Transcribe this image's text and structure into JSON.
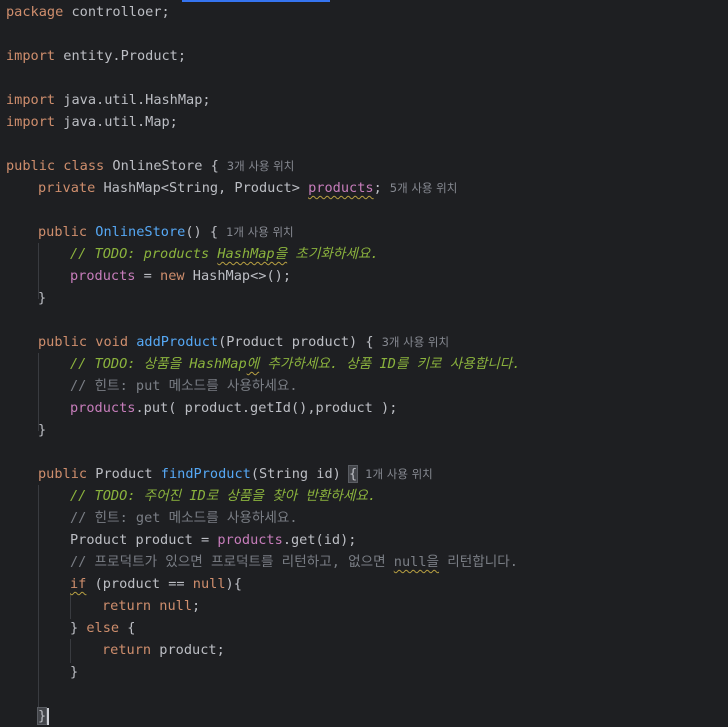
{
  "code": {
    "l1": {
      "kw": "package",
      "rest": " controlloer;"
    },
    "l2": {
      "kw": "import",
      "rest": " entity.Product;"
    },
    "l3": {
      "kw": "import",
      "rest": " java.util.HashMap;"
    },
    "l4": {
      "kw": "import",
      "rest": " java.util.Map;"
    },
    "l5": {
      "kw": "public class",
      "rest": " OnlineStore {",
      "hint": "3개 사용 위치"
    },
    "l6": {
      "kw": "private",
      "mid": " HashMap<String, Product> ",
      "field": "products",
      "end": ";",
      "hint": "5개 사용 위치"
    },
    "l7": {
      "kw": "public",
      "space": " ",
      "fn": "OnlineStore",
      "rest": "() {",
      "hint": "1개 사용 위치"
    },
    "l8": {
      "pre": "// TODO: products ",
      "w": "HashMap을",
      "post": " 초기화하세요."
    },
    "l9": {
      "field": "products",
      "mid": " = ",
      "kw": "new",
      "rest": " HashMap<>();"
    },
    "l10": {
      "text": "}"
    },
    "l11": {
      "kw": "public void",
      "space": " ",
      "fn": "addProduct",
      "rest": "(Product product) {",
      "hint": "3개 사용 위치"
    },
    "l12": {
      "pre": "// TODO: 상품을 HashMap",
      "w": "에",
      "post": " 추가하세요. 상품 ID를 키로 사용합니다."
    },
    "l13": {
      "text": "// 힌트: put 메소드를 사용하세요."
    },
    "l14": {
      "field": "products",
      "rest": ".put( product.getId(),product );"
    },
    "l15": {
      "text": "}"
    },
    "l16": {
      "kw": "public",
      "mid": " Product ",
      "fn": "findProduct",
      "rest": "(String id) ",
      "brace": "{",
      "hint": "1개 사용 위치"
    },
    "l17": {
      "text": "// TODO: 주어진 ID로 상품을 찾아 반환하세요."
    },
    "l18": {
      "text": "// 힌트: get 메소드를 사용하세요."
    },
    "l19": {
      "pre": "Product product = ",
      "field": "products",
      "rest": ".get(id);"
    },
    "l20": {
      "pre": "// 프로덕트가 있으면 프로덕트를 리턴하고, 없으면 ",
      "w": "null을",
      "post": " 리턴합니다."
    },
    "l21": {
      "kw": "if",
      "mid": " (product == ",
      "kw2": "null",
      "rest": "){"
    },
    "l22": {
      "kw": "return",
      "space": " ",
      "kw2": "null",
      "rest": ";"
    },
    "l23": {
      "pre": "} ",
      "kw": "else",
      "rest": " {"
    },
    "l24": {
      "kw": "return",
      "rest": " product;"
    },
    "l25": {
      "text": "}"
    },
    "l26": {
      "text": "}"
    }
  }
}
